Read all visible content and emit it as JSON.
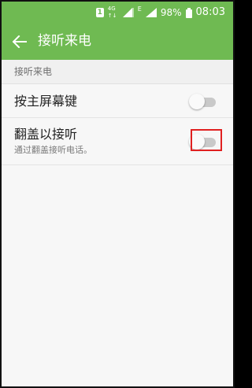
{
  "status_bar": {
    "sim_label": "1",
    "network_top": "4G",
    "network_bottom": "↑↓",
    "signal_label": "E",
    "battery": "98%",
    "time": "08:03"
  },
  "app_bar": {
    "title": "接听来电",
    "back_icon": "arrow-left-icon"
  },
  "section": {
    "header": "接听来电"
  },
  "settings": [
    {
      "title": "按主屏幕键",
      "subtitle": "",
      "enabled": false
    },
    {
      "title": "翻盖以接听",
      "subtitle": "通过翻盖接听电话。",
      "enabled": false,
      "highlighted": true
    }
  ],
  "colors": {
    "accent": "#6fba52",
    "toggle_off_track": "#c9c9c9",
    "highlight": "#e02020",
    "background": "#f7f7f7"
  }
}
